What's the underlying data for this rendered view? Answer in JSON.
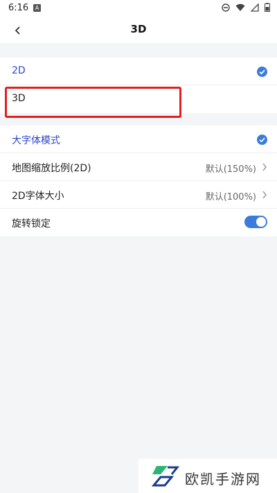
{
  "status_bar": {
    "time": "6:16",
    "icons": [
      "notification-a-icon",
      "dnd-icon",
      "wifi-icon",
      "signal-icon",
      "battery-icon"
    ]
  },
  "header": {
    "title": "3D",
    "back_icon": "chevron-left-icon"
  },
  "view_mode_group": {
    "items": [
      {
        "label": "2D",
        "selected": true
      },
      {
        "label": "3D",
        "selected": false
      }
    ]
  },
  "settings_group": {
    "items": [
      {
        "label": "大字体模式",
        "selected": true
      },
      {
        "label": "地图缩放比例(2D)",
        "value": "默认(150%)"
      },
      {
        "label": "2D字体大小",
        "value": "默认(100%)"
      },
      {
        "label": "旋转锁定",
        "toggle_on": true
      }
    ]
  },
  "watermark": {
    "text": "欧凯手游网"
  },
  "colors": {
    "accent": "#3a7cde",
    "selected_text": "#2b45c9",
    "annotation_red": "#e02020",
    "background": "#f4f5f7"
  }
}
